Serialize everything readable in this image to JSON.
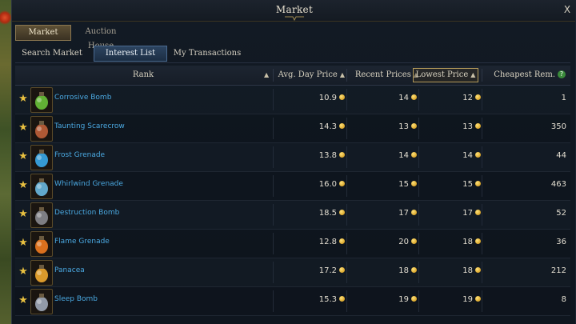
{
  "window": {
    "title": "Market",
    "close_label": "X"
  },
  "top_tabs": [
    {
      "label": "Market",
      "active": true
    },
    {
      "label": "Auction House",
      "active": false
    }
  ],
  "sub_tabs": [
    {
      "label": "Search Market",
      "active": false
    },
    {
      "label": "Interest List",
      "active": true
    },
    {
      "label": "My Transactions",
      "active": false
    }
  ],
  "columns": {
    "rank": "Rank",
    "avg_day_price": "Avg. Day Price",
    "recent_prices": "Recent Prices",
    "lowest_price": "Lowest Price",
    "cheapest_rem": "Cheapest Rem.",
    "sort_arrow": "▲",
    "help_glyph": "?"
  },
  "items": [
    {
      "name": "Corrosive Bomb",
      "icon": "corrosive-bomb-icon",
      "color": "#6ac23a",
      "avg": "10.9",
      "recent": "14",
      "lowest": "12",
      "cheapest_rem": "1"
    },
    {
      "name": "Taunting Scarecrow",
      "icon": "taunting-scarecrow-icon",
      "color": "#c0603a",
      "avg": "14.3",
      "recent": "13",
      "lowest": "13",
      "cheapest_rem": "350"
    },
    {
      "name": "Frost Grenade",
      "icon": "frost-grenade-icon",
      "color": "#3aa8e8",
      "avg": "13.8",
      "recent": "14",
      "lowest": "14",
      "cheapest_rem": "44"
    },
    {
      "name": "Whirlwind Grenade",
      "icon": "whirlwind-grenade-icon",
      "color": "#6ab8e0",
      "avg": "16.0",
      "recent": "15",
      "lowest": "15",
      "cheapest_rem": "463"
    },
    {
      "name": "Destruction Bomb",
      "icon": "destruction-bomb-icon",
      "color": "#8a8a90",
      "avg": "18.5",
      "recent": "17",
      "lowest": "17",
      "cheapest_rem": "52"
    },
    {
      "name": "Flame Grenade",
      "icon": "flame-grenade-icon",
      "color": "#f07a20",
      "avg": "12.8",
      "recent": "20",
      "lowest": "18",
      "cheapest_rem": "36"
    },
    {
      "name": "Panacea",
      "icon": "panacea-icon",
      "color": "#f0a830",
      "avg": "17.2",
      "recent": "18",
      "lowest": "18",
      "cheapest_rem": "212"
    },
    {
      "name": "Sleep Bomb",
      "icon": "sleep-bomb-icon",
      "color": "#a0a8b8",
      "avg": "15.3",
      "recent": "19",
      "lowest": "19",
      "cheapest_rem": "8"
    }
  ],
  "colors": {
    "item_name": "#4aa8e0",
    "star": "#e8c040",
    "selected_header_border": "#b49a5a"
  }
}
